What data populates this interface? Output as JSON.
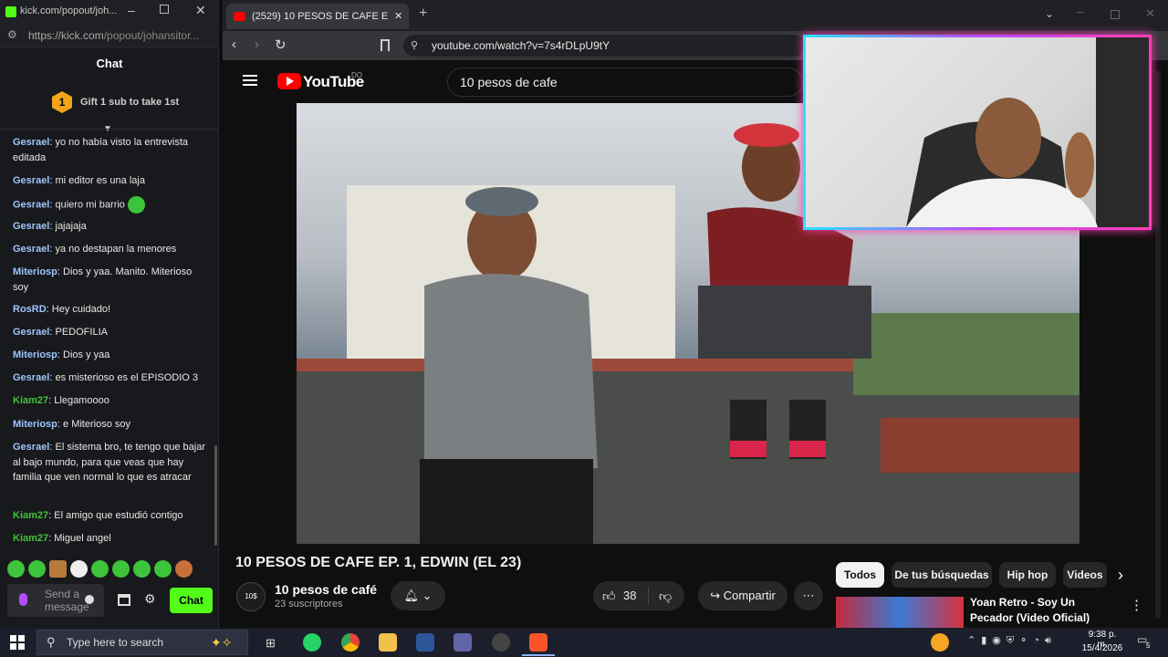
{
  "kick": {
    "title": "kick.com/popout/joh...",
    "url_host": "https://kick.com",
    "url_path": "/popout/johansitor...",
    "chat_header": "Chat",
    "gift_text": "Gift 1 sub to take 1st",
    "gift_number": "1",
    "messages": [
      {
        "user": "Gesrael",
        "text": "yo no había visto la entrevista editada"
      },
      {
        "user": "Gesrael",
        "text": "mi editor es una laja"
      },
      {
        "user": "Gesrael",
        "text": "quiero mi barrio"
      },
      {
        "user": "Gesrael",
        "text": "jajajaja"
      },
      {
        "user": "Gesrael",
        "text": "ya no destapan la menores"
      },
      {
        "user": "Miteriosp",
        "text": "Dios y yaa. Manito. Miterioso soy"
      },
      {
        "user": "RosRD",
        "text": "Hey cuidado!"
      },
      {
        "user": "Gesrael",
        "text": "PEDOFILIA"
      },
      {
        "user": "Miteriosp",
        "text": "Dios y yaa"
      },
      {
        "user": "Gesrael",
        "text": "es misterioso es el EPISODIO 3"
      },
      {
        "user": "Kiam27",
        "text": "Llegamoooo"
      },
      {
        "user": "Miteriosp",
        "text": "e Miterioso soy"
      },
      {
        "user": "Gesrael",
        "text": "El sistema bro, te tengo que bajar al bajo mundo, para que veas que hay familia que ven normal lo que es atracar"
      },
      {
        "user": "Kiam27",
        "text": "El amigo que estudió contigo"
      },
      {
        "user": "Kiam27",
        "text": "Miguel angel"
      }
    ],
    "input_placeholder": "Send a message",
    "chat_button": "Chat"
  },
  "browser": {
    "tab_title": "(2529) 10 PESOS DE CAFE EP. 1, E",
    "url": "youtube.com/watch?v=7s4rDLpU9tY"
  },
  "youtube": {
    "logo": "YouTube",
    "country": "DO",
    "search_value": "10 pesos de cafe",
    "video_title": "10 PESOS DE CAFE EP. 1, EDWIN (EL 23)",
    "channel_name": "10 pesos de café",
    "subscribers": "23 suscriptores",
    "likes": "38",
    "share_label": "Compartir",
    "chips": [
      "Todos",
      "De tus búsquedas",
      "Hip hop",
      "Videos"
    ],
    "rec_title": "Yoan Retro - Soy Un Pecador (Video Oficial)"
  },
  "taskbar": {
    "search_placeholder": "Type here to search",
    "time": "9:38 p. m.",
    "date": "15/4/2026",
    "notif_count": "5"
  },
  "colors": {
    "kick_green": "#53fc18",
    "yt_red": "#ff0000",
    "username_green": "#3ec43a",
    "username_blue": "#9ec5ff"
  }
}
